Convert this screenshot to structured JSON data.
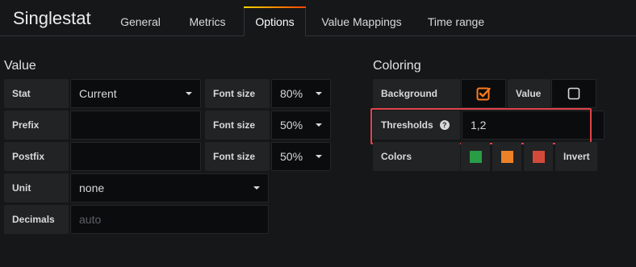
{
  "header": {
    "title": "Singlestat",
    "tabs": [
      "General",
      "Metrics",
      "Options",
      "Value Mappings",
      "Time range"
    ],
    "active_tab": "Options"
  },
  "value_section": {
    "title": "Value",
    "stat_label": "Stat",
    "stat_value": "Current",
    "prefix_label": "Prefix",
    "prefix_value": "",
    "postfix_label": "Postfix",
    "postfix_value": "",
    "unit_label": "Unit",
    "unit_value": "none",
    "decimals_label": "Decimals",
    "decimals_placeholder": "auto",
    "font_size_label": "Font size",
    "font_sizes": [
      "80%",
      "50%",
      "50%"
    ]
  },
  "coloring_section": {
    "title": "Coloring",
    "background_label": "Background",
    "background_checked": true,
    "value_label": "Value",
    "value_checked": false,
    "thresholds_label": "Thresholds",
    "thresholds_value": "1,2",
    "colors_label": "Colors",
    "colors": [
      "#299c46",
      "#ed8128",
      "#d44a3a"
    ],
    "invert_label": "Invert"
  },
  "accent_color": "#ff7a1a",
  "highlight_color": "#e0444a"
}
